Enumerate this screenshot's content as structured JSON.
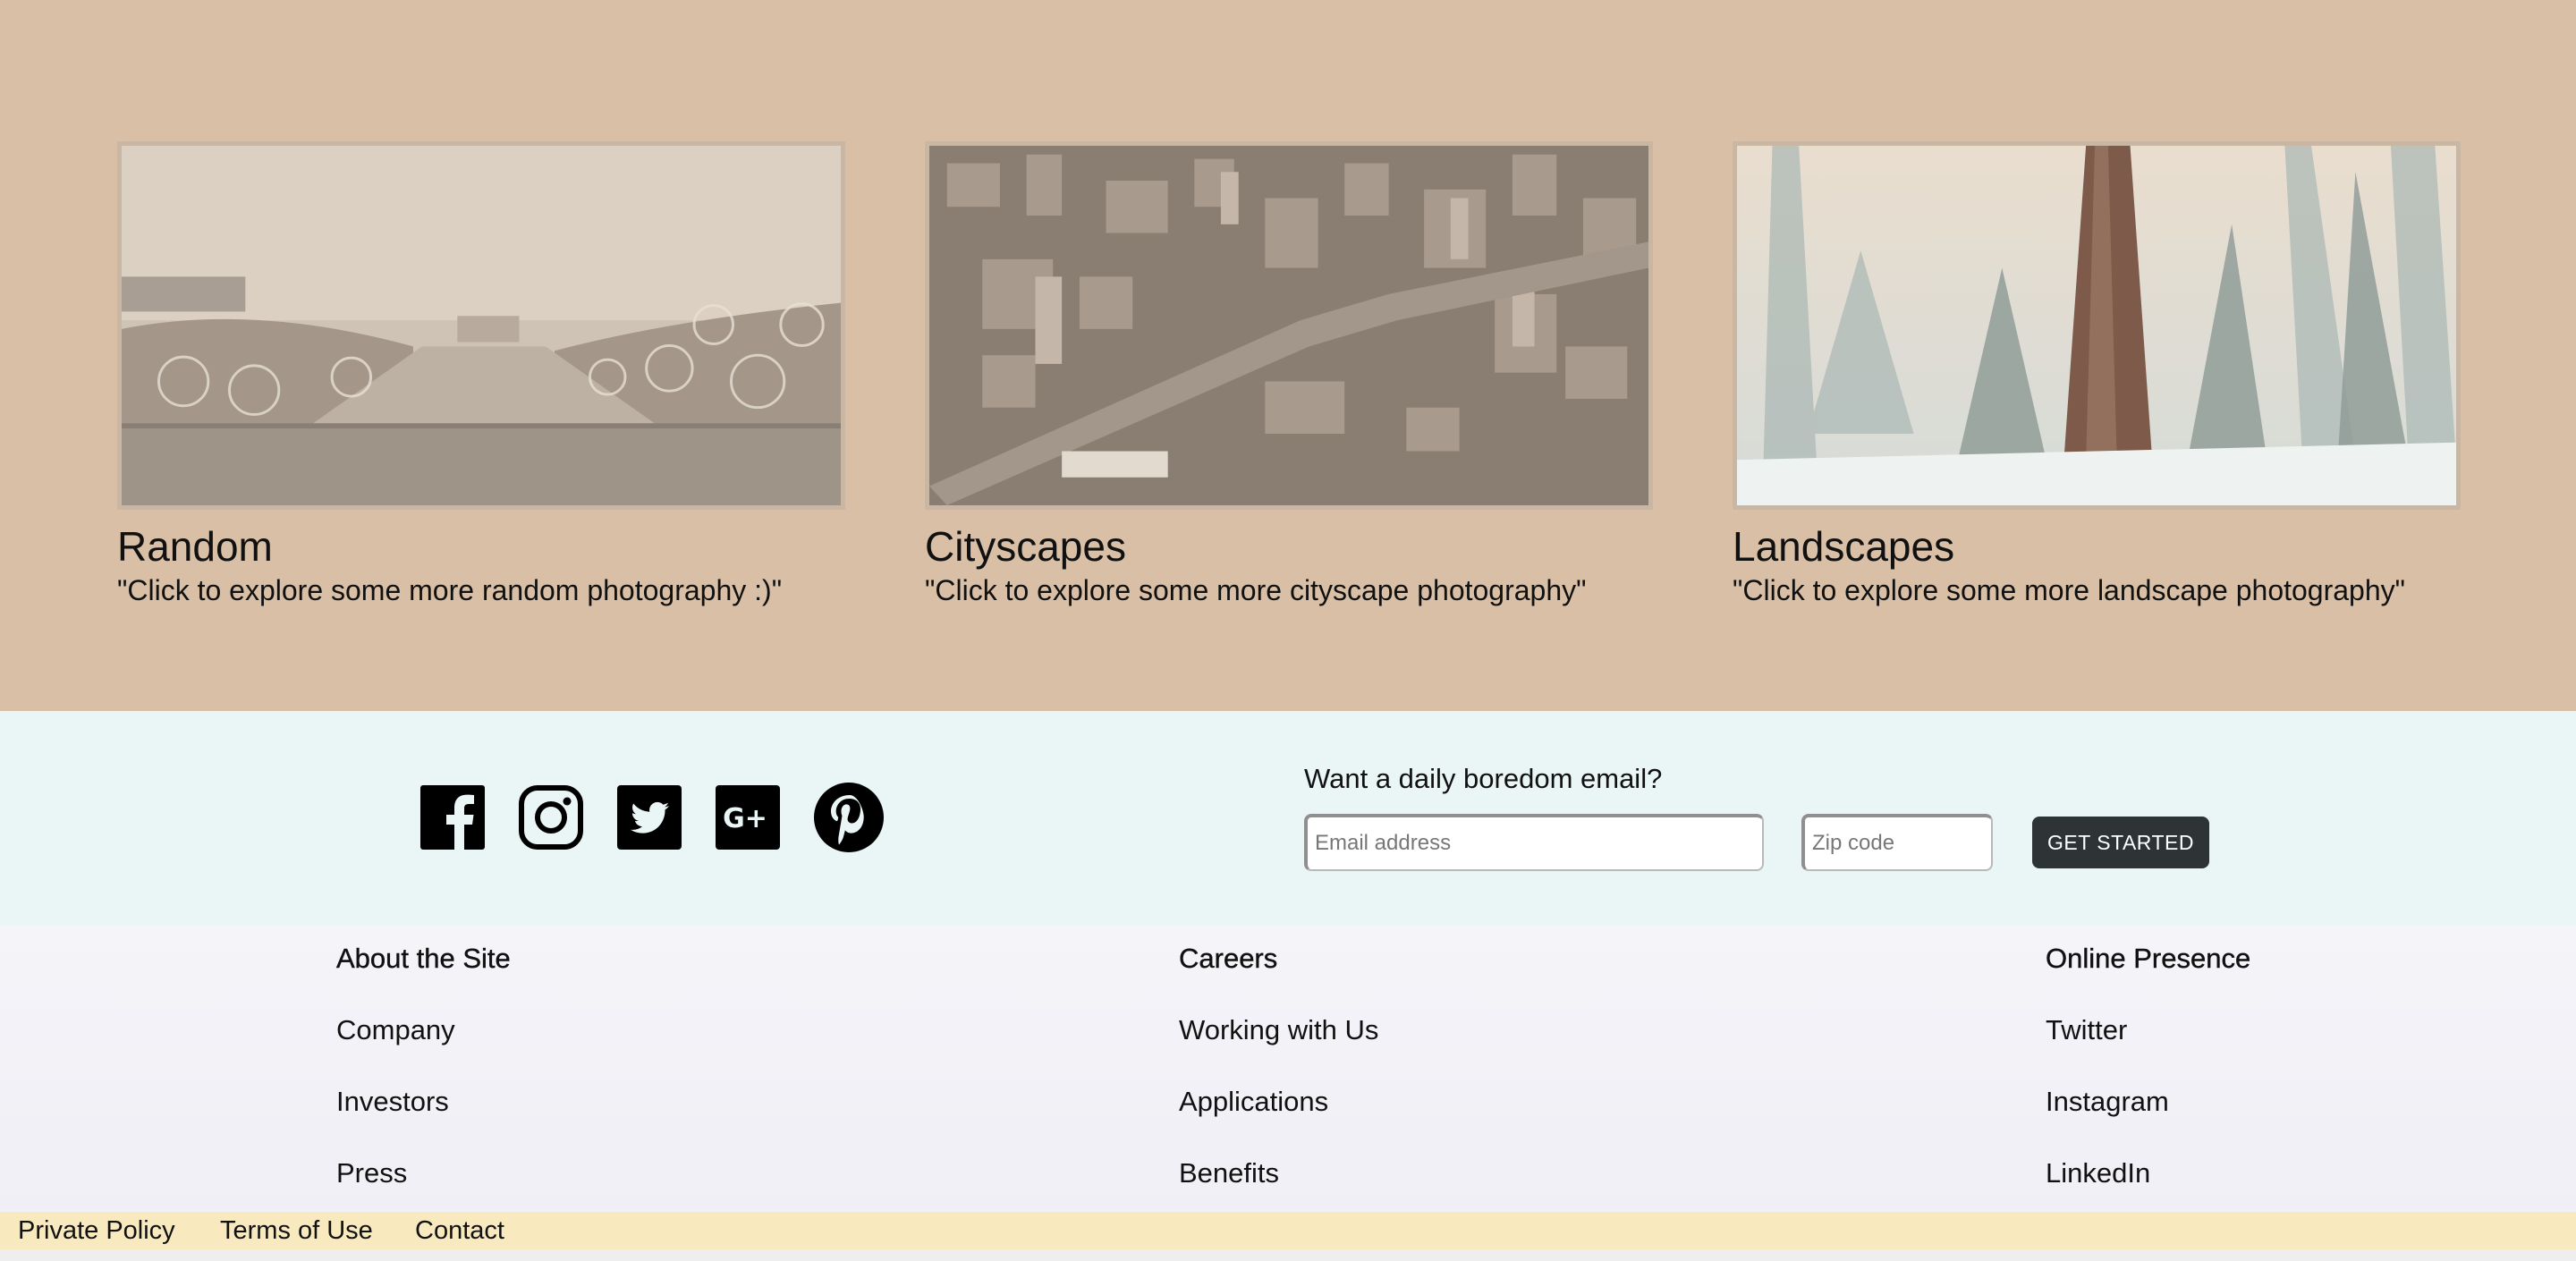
{
  "gallery": {
    "cards": [
      {
        "title": "Random",
        "description": "\"Click to explore some more random photography :)\"",
        "image": "bicycles-photo"
      },
      {
        "title": "Cityscapes",
        "description": "\"Click to explore some more cityscape photography\"",
        "image": "city-aerial-photo"
      },
      {
        "title": "Landscapes",
        "description": "\"Click to explore some more landscape photography\"",
        "image": "forest-sequoia-photo"
      }
    ]
  },
  "social": {
    "icons": [
      "facebook-icon",
      "instagram-icon",
      "twitter-icon",
      "google-plus-icon",
      "pinterest-icon"
    ]
  },
  "newsletter": {
    "label": "Want a daily boredom email?",
    "email_placeholder": "Email address",
    "email_value": "",
    "zip_placeholder": "Zip code",
    "zip_value": "",
    "button_label": "GET STARTED"
  },
  "footer": {
    "columns": [
      {
        "heading": "About the Site",
        "links": [
          "Company",
          "Investors",
          "Press"
        ]
      },
      {
        "heading": "Careers",
        "links": [
          "Working with Us",
          "Applications",
          "Benefits"
        ]
      },
      {
        "heading": "Online Presence",
        "links": [
          "Twitter",
          "Instagram",
          "LinkedIn"
        ]
      }
    ]
  },
  "legal": {
    "links": [
      "Private Policy",
      "Terms of Use",
      "Contact"
    ]
  },
  "colors": {
    "gallery_bg": "#d8bfa5",
    "band_bg": "#eaf6f5",
    "footer_bg": "#f5f4f9",
    "legal_bg": "#f8e9bf",
    "button_bg": "#2e3436"
  }
}
